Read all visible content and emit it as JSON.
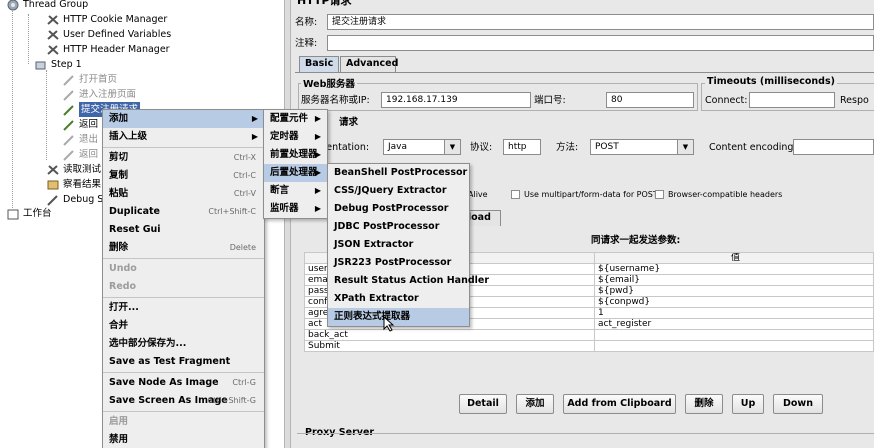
{
  "tree": {
    "root": {
      "label": "Thread Group"
    },
    "children": [
      {
        "label": "HTTP Cookie Manager",
        "icon": "wrench-icon"
      },
      {
        "label": "User Defined Variables",
        "icon": "wrench-icon"
      },
      {
        "label": "HTTP Header Manager",
        "icon": "wrench-icon"
      }
    ],
    "step": {
      "label": "Step 1"
    },
    "step_children": [
      {
        "label": "打开首页"
      },
      {
        "label": "进入注册页面"
      },
      {
        "label": "提交注册请求"
      },
      {
        "label": "返回"
      },
      {
        "label": "退出"
      },
      {
        "label": "返回"
      }
    ],
    "after_step": [
      {
        "label": "读取测试"
      },
      {
        "label": "察看结果"
      },
      {
        "label": "Debug S"
      }
    ],
    "workbench": {
      "label": "工作台"
    }
  },
  "context_menu": {
    "items": [
      {
        "label": "添加",
        "submenu": true,
        "highlight": true
      },
      {
        "label": "插入上级",
        "submenu": true
      },
      {
        "sep": true
      },
      {
        "label": "剪切",
        "shortcut": "Ctrl-X"
      },
      {
        "label": "复制",
        "shortcut": "Ctrl-C"
      },
      {
        "label": "粘贴",
        "shortcut": "Ctrl-V"
      },
      {
        "label": "Duplicate",
        "shortcut": "Ctrl+Shift-C"
      },
      {
        "label": "Reset Gui"
      },
      {
        "label": "删除",
        "shortcut": "Delete"
      },
      {
        "sep": true
      },
      {
        "label": "Undo",
        "disabled": true
      },
      {
        "label": "Redo",
        "disabled": true
      },
      {
        "sep": true
      },
      {
        "label": "打开..."
      },
      {
        "label": "合并"
      },
      {
        "label": "选中部分保存为..."
      },
      {
        "label": "Save as Test Fragment"
      },
      {
        "sep": true
      },
      {
        "label": "Save Node As Image",
        "shortcut": "Ctrl-G"
      },
      {
        "label": "Save Screen As Image",
        "shortcut": "Ctrl+Shift-G"
      },
      {
        "sep": true
      },
      {
        "label": "启用",
        "disabled": true
      },
      {
        "label": "禁用"
      }
    ]
  },
  "add_submenu": {
    "items": [
      {
        "label": "配置元件"
      },
      {
        "label": "定时器"
      },
      {
        "label": "前置处理器"
      },
      {
        "label": "后置处理器",
        "highlight": true
      },
      {
        "label": "断言"
      },
      {
        "label": "监听器"
      }
    ]
  },
  "post_processor_submenu": {
    "items": [
      {
        "label": "BeanShell PostProcessor"
      },
      {
        "label": "CSS/JQuery Extractor"
      },
      {
        "label": "Debug PostProcessor"
      },
      {
        "label": "JDBC PostProcessor"
      },
      {
        "label": "JSON Extractor"
      },
      {
        "label": "JSR223 PostProcessor"
      },
      {
        "label": "Result Status Action Handler"
      },
      {
        "label": "XPath Extractor"
      },
      {
        "label": "正则表达式提取器",
        "highlight": true
      }
    ]
  },
  "form": {
    "header_title": "HTTP请求",
    "name_label": "名称:",
    "name_value": "提交注册请求",
    "comment_label": "注释:",
    "tabs": [
      "Basic",
      "Advanced"
    ],
    "web_server_title": "Web服务器",
    "server_label": "服务器名称或IP:",
    "server_value": "192.168.17.139",
    "port_label": "端口号:",
    "port_value": "80",
    "timeouts_title": "Timeouts (milliseconds)",
    "connect_label": "Connect:",
    "response_label": "Respo",
    "request_title": "请求",
    "impl_label": "mentation:",
    "impl_value": "Java",
    "protocol_label": "协议:",
    "protocol_value": "http",
    "method_label": "方法:",
    "method_value": "POST",
    "encoding_label": "Content encoding:",
    "keepalive_label": "epAlive",
    "multipart_label": "Use multipart/form-data for POST",
    "browser_headers_label": "Browser-compatible headers",
    "upload_tab": "pload",
    "params_title": "同请求一起发送参数:",
    "params_value_header": "值",
    "params": [
      {
        "name": "usern",
        "value": "${username}"
      },
      {
        "name": "email",
        "value": "${email}"
      },
      {
        "name": "passw",
        "value": "${pwd}"
      },
      {
        "name": "confi",
        "value": "${conpwd}"
      },
      {
        "name": "agree",
        "value": "1"
      },
      {
        "name": "act",
        "value": "act_register"
      },
      {
        "name": "back_act",
        "value": ""
      },
      {
        "name": "Submit",
        "value": ""
      }
    ],
    "buttons": [
      "Detail",
      "添加",
      "Add from Clipboard",
      "删除",
      "Up",
      "Down"
    ],
    "proxy_title": "Proxy Server"
  }
}
